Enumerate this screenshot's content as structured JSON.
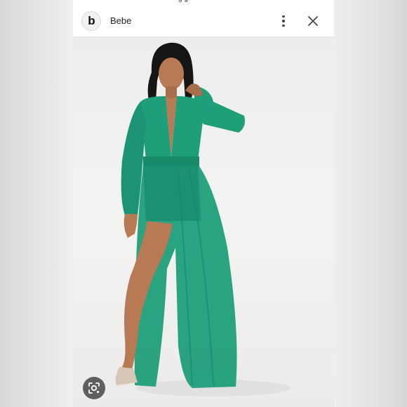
{
  "top_strip": {
    "text": "g g"
  },
  "header": {
    "logo_text": "b",
    "site_name": "Bebe",
    "more_icon": "more-vert-icon",
    "close_icon": "close-icon"
  },
  "image": {
    "subject": "model-in-green-maxi-dress",
    "dress_color": "#1f9e7a"
  },
  "lens": {
    "icon": "google-lens-icon"
  }
}
